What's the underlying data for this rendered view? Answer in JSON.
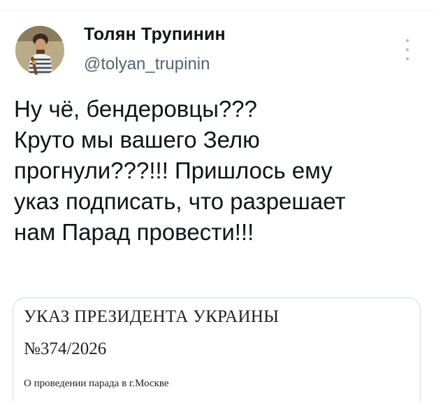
{
  "author": {
    "name": "Толян Трупинин",
    "handle": "@tolyan_trupinin"
  },
  "tweet": {
    "lines": [
      "Ну чё, бендеровцы???",
      "Круто мы вашего Зелю",
      "прогнули???!!! Пришлось ему",
      "указ подписать, что разрешает",
      "нам Парад провести!!!"
    ]
  },
  "card": {
    "title": "УКАЗ ПРЕЗИДЕНТА УКРАИНЫ",
    "number": "№374/2026",
    "subtitle": "О проведении парада в г.Москве"
  },
  "icons": {
    "more": "more-vertical-icon"
  }
}
